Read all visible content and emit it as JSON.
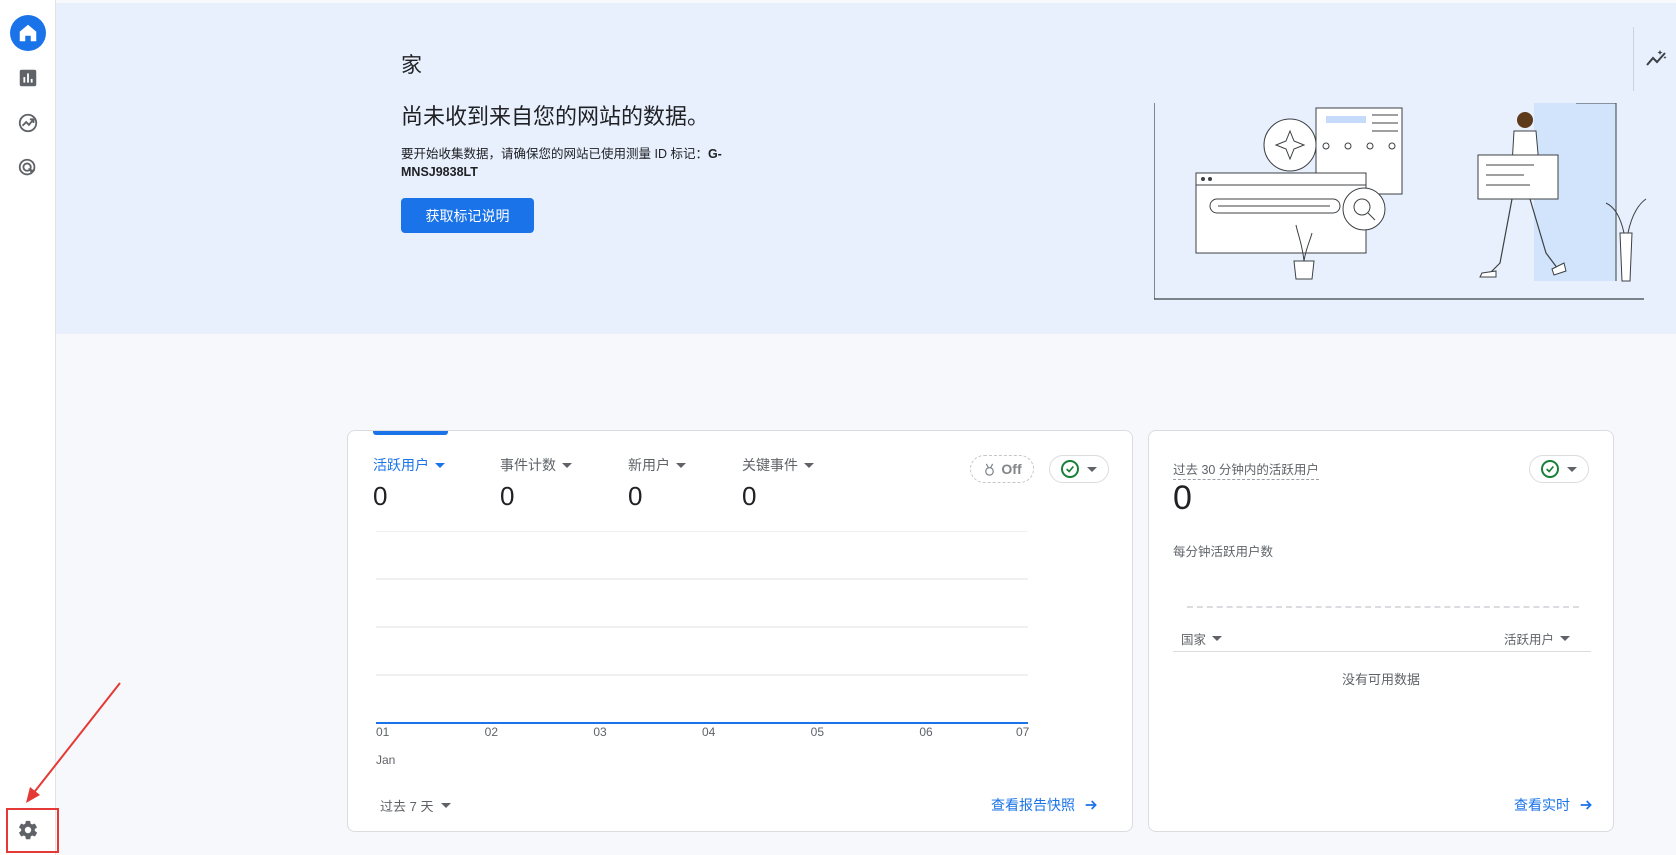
{
  "sidebar": {
    "items": [
      {
        "name": "home",
        "icon": "home-icon",
        "active": true
      },
      {
        "name": "reports",
        "icon": "bar-chart-icon",
        "active": false
      },
      {
        "name": "explore",
        "icon": "explore-icon",
        "active": false
      },
      {
        "name": "advertising",
        "icon": "target-cursor-icon",
        "active": false
      }
    ],
    "settings_icon": "gear-icon"
  },
  "hero": {
    "page_title": "家",
    "headline": "尚未收到来自您的网站的数据。",
    "desc_prefix": "要开始收集数据，请确保您的网站已使用测量 ID 标记：",
    "measurement_id": "G-MNSJ9838LT",
    "button_label": "获取标记说明",
    "insights_icon": "insights-icon"
  },
  "overview": {
    "metrics": [
      {
        "label": "活跃用户",
        "value": "0",
        "active": true
      },
      {
        "label": "事件计数",
        "value": "0",
        "active": false
      },
      {
        "label": "新用户",
        "value": "0",
        "active": false
      },
      {
        "label": "关键事件",
        "value": "0",
        "active": false
      }
    ],
    "compare_chip": "Off",
    "x_ticks": [
      "01",
      "02",
      "03",
      "04",
      "05",
      "06",
      "07"
    ],
    "x_month": "Jan",
    "range_label": "过去 7 天",
    "link_label": "查看报告快照"
  },
  "chart_data": {
    "type": "line",
    "x": [
      "01",
      "02",
      "03",
      "04",
      "05",
      "06",
      "07"
    ],
    "series": [
      {
        "values": [
          0,
          0,
          0,
          0,
          0,
          0,
          0
        ]
      }
    ],
    "grid": true
  },
  "realtime": {
    "title": "过去 30 分钟内的活跃用户",
    "value": "0",
    "subtitle": "每分钟活跃用户数",
    "col_country": "国家",
    "col_users": "活跃用户",
    "empty_text": "没有可用数据",
    "link_label": "查看实时"
  },
  "colors": {
    "accent": "#1a73e8",
    "hero_bg": "#e8f0fe",
    "success": "#188038",
    "annotation_red": "#e53935"
  }
}
